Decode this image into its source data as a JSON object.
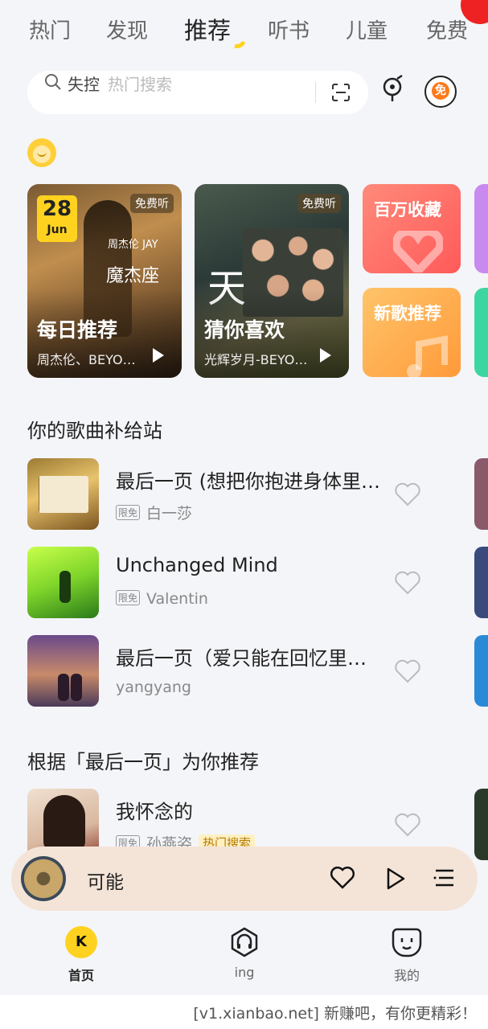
{
  "tabs": [
    {
      "label": "热门"
    },
    {
      "label": "发现"
    },
    {
      "label": "推荐",
      "active": true
    },
    {
      "label": "听书"
    },
    {
      "label": "儿童"
    },
    {
      "label": "免费"
    }
  ],
  "search": {
    "keyword": "失控",
    "placeholder": "热门搜索"
  },
  "free_badge": "免",
  "cards": [
    {
      "date_day": "28",
      "date_month": "Jun",
      "tag": "免费听",
      "title": "每日推荐",
      "subtitle": "周杰伦、BEYOND",
      "cover_artist": "周杰伦 JAY",
      "cover_album": "魔杰座"
    },
    {
      "tag": "免费听",
      "title": "猜你喜欢",
      "subtitle": "光辉岁月-BEYOND",
      "cover_text": "天"
    }
  ],
  "mini_cards": [
    {
      "label": "百万收藏"
    },
    {
      "label": "新歌推荐"
    }
  ],
  "sections": [
    {
      "title": "你的歌曲补给站",
      "songs": [
        {
          "name": "最后一页 (想把你抱进身体里面)",
          "artist": "白一莎",
          "limited": "限免"
        },
        {
          "name": "Unchanged Mind",
          "artist": "Valentin",
          "limited": "限免"
        },
        {
          "name": "最后一页（爱只能在回忆里完整）",
          "artist": "yangyang"
        }
      ]
    },
    {
      "title": "根据「最后一页」为你推荐",
      "songs": [
        {
          "name": "我怀念的",
          "artist": "孙燕姿",
          "limited": "限免",
          "hot": "热门搜索"
        }
      ]
    }
  ],
  "player": {
    "song": "可能"
  },
  "nav": [
    {
      "label": "首页",
      "active": true
    },
    {
      "label": "ing"
    },
    {
      "label": "我的"
    }
  ],
  "footer": "[v1.xianbao.net] 新赚吧，有你更精彩！"
}
